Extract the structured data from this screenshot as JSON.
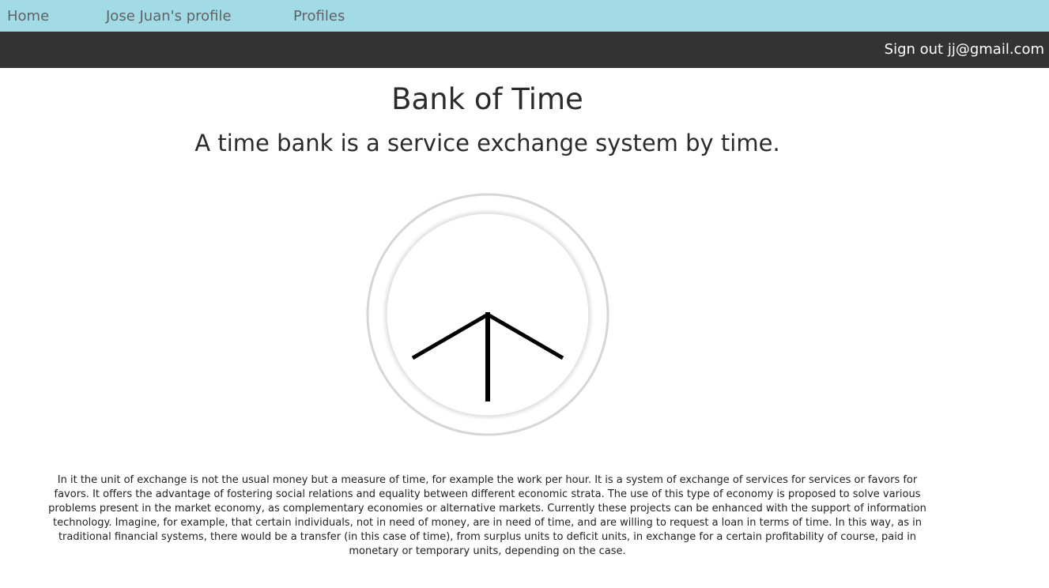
{
  "nav": {
    "home_label": "Home",
    "profile_label": "Jose Juan's profile",
    "profiles_label": "Profiles"
  },
  "userbar": {
    "signout_label": "Sign out jj@gmail.com"
  },
  "main": {
    "title": "Bank of Time",
    "subtitle": "A time bank is a service exchange system by time.",
    "description": "In it the unit of exchange is not the usual money but a measure of time, for example the work per hour. It is a system of exchange of services for services or favors for favors. It offers the advantage of fostering social relations and equality between different economic strata. The use of this type of economy is proposed to solve various problems present in the market economy, as complementary economies or alternative markets. Currently these projects can be enhanced with the support of information technology. Imagine, for example, that certain individuals, not in need of money, are in need of time, and are willing to request a loan in terms of time. In this way, as in traditional financial systems, there would be a transfer (in this case of time), from surplus units to deficit units, in exchange for a certain profitability of course, paid in monetary or temporary units, depending on the case."
  },
  "colors": {
    "nav_bg": "#a2dae6",
    "userbar_bg": "#333333",
    "clock_hand": "#000000",
    "clock_ring": "#d6d6d6"
  }
}
